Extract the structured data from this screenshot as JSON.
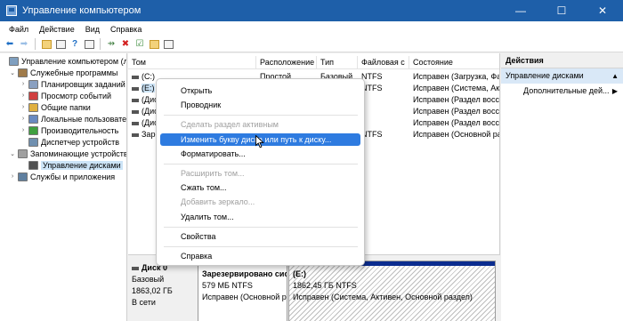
{
  "window": {
    "title": "Управление компьютером",
    "controls": {
      "minimize": "—",
      "maximize": "☐",
      "close": "✕"
    }
  },
  "menubar": [
    "Файл",
    "Действие",
    "Вид",
    "Справка"
  ],
  "toolbar_icons": [
    "back-icon",
    "forward-icon",
    "up-folder-icon",
    "console-tree-icon",
    "help-icon",
    "properties-icon",
    "connect-icon",
    "delete-icon",
    "checklist-icon",
    "folder-search-icon",
    "action-pane-icon"
  ],
  "tree": [
    {
      "label": "Управление компьютером (л",
      "level": 0,
      "expander": ""
    },
    {
      "label": "Служебные программы",
      "level": 1,
      "expander": "⌄"
    },
    {
      "label": "Планировщик заданий",
      "level": 2,
      "expander": "›"
    },
    {
      "label": "Просмотр событий",
      "level": 2,
      "expander": "›"
    },
    {
      "label": "Общие папки",
      "level": 2,
      "expander": "›"
    },
    {
      "label": "Локальные пользовате",
      "level": 2,
      "expander": "›"
    },
    {
      "label": "Производительность",
      "level": 2,
      "expander": "›"
    },
    {
      "label": "Диспетчер устройств",
      "level": 2,
      "expander": ""
    },
    {
      "label": "Запоминающие устройств",
      "level": 1,
      "expander": "⌄"
    },
    {
      "label": "Управление дисками",
      "level": 2,
      "expander": "",
      "selected": true
    },
    {
      "label": "Службы и приложения",
      "level": 1,
      "expander": "›"
    }
  ],
  "table": {
    "columns": [
      "Том",
      "Расположение",
      "Тип",
      "Файловая с",
      "Состояние"
    ],
    "rows": [
      {
        "vol": "(C:)",
        "layout": "Простой",
        "type": "Базовый",
        "fs": "NTFS",
        "status": "Исправен (Загрузка, Фай"
      },
      {
        "vol": "(E:)",
        "layout": "Простой",
        "type": "Базовый",
        "fs": "NTFS",
        "status": "Исправен (Система, Акти",
        "selected": true
      },
      {
        "vol": "(Дис",
        "layout": "",
        "type": "",
        "fs": "",
        "status": "Исправен (Раздел восст"
      },
      {
        "vol": "(Дис",
        "layout": "",
        "type": "",
        "fs": "",
        "status": "Исправен (Раздел восст"
      },
      {
        "vol": "(Дис",
        "layout": "",
        "type": "",
        "fs": "",
        "status": "Исправен (Раздел восст"
      },
      {
        "vol": "Заре",
        "layout": "",
        "type": "",
        "fs": "NTFS",
        "status": "Исправен (Основной раз"
      }
    ]
  },
  "disk": {
    "name": "Диск 0",
    "kind": "Базовый",
    "size": "1863,02 ГБ",
    "state": "В сети",
    "partitions": [
      {
        "name": "Зарезервировано сис",
        "size": "579 МБ NTFS",
        "status": "Исправен (Основной р"
      },
      {
        "name": "(E:)",
        "size": "1862,45 ГБ NTFS",
        "status": "Исправен (Система, Активен, Основной раздел)"
      }
    ]
  },
  "actions": {
    "header": "Действия",
    "section": "Управление дисками",
    "section_arrow": "▲",
    "items": [
      {
        "label": "Дополнительные дей...",
        "arrow": "▶"
      }
    ]
  },
  "context_menu": [
    {
      "label": "Открыть",
      "disabled": false
    },
    {
      "label": "Проводник",
      "disabled": false
    },
    {
      "sep": true
    },
    {
      "label": "Сделать раздел активным",
      "disabled": true
    },
    {
      "label": "Изменить букву диска или путь к диску...",
      "disabled": false,
      "highlight": true
    },
    {
      "label": "Форматировать...",
      "disabled": false
    },
    {
      "sep": true
    },
    {
      "label": "Расширить том...",
      "disabled": true
    },
    {
      "label": "Сжать том...",
      "disabled": false
    },
    {
      "label": "Добавить зеркало...",
      "disabled": true
    },
    {
      "label": "Удалить том...",
      "disabled": false
    },
    {
      "sep": true
    },
    {
      "label": "Свойства",
      "disabled": false
    },
    {
      "sep": true
    },
    {
      "label": "Справка",
      "disabled": false
    }
  ]
}
